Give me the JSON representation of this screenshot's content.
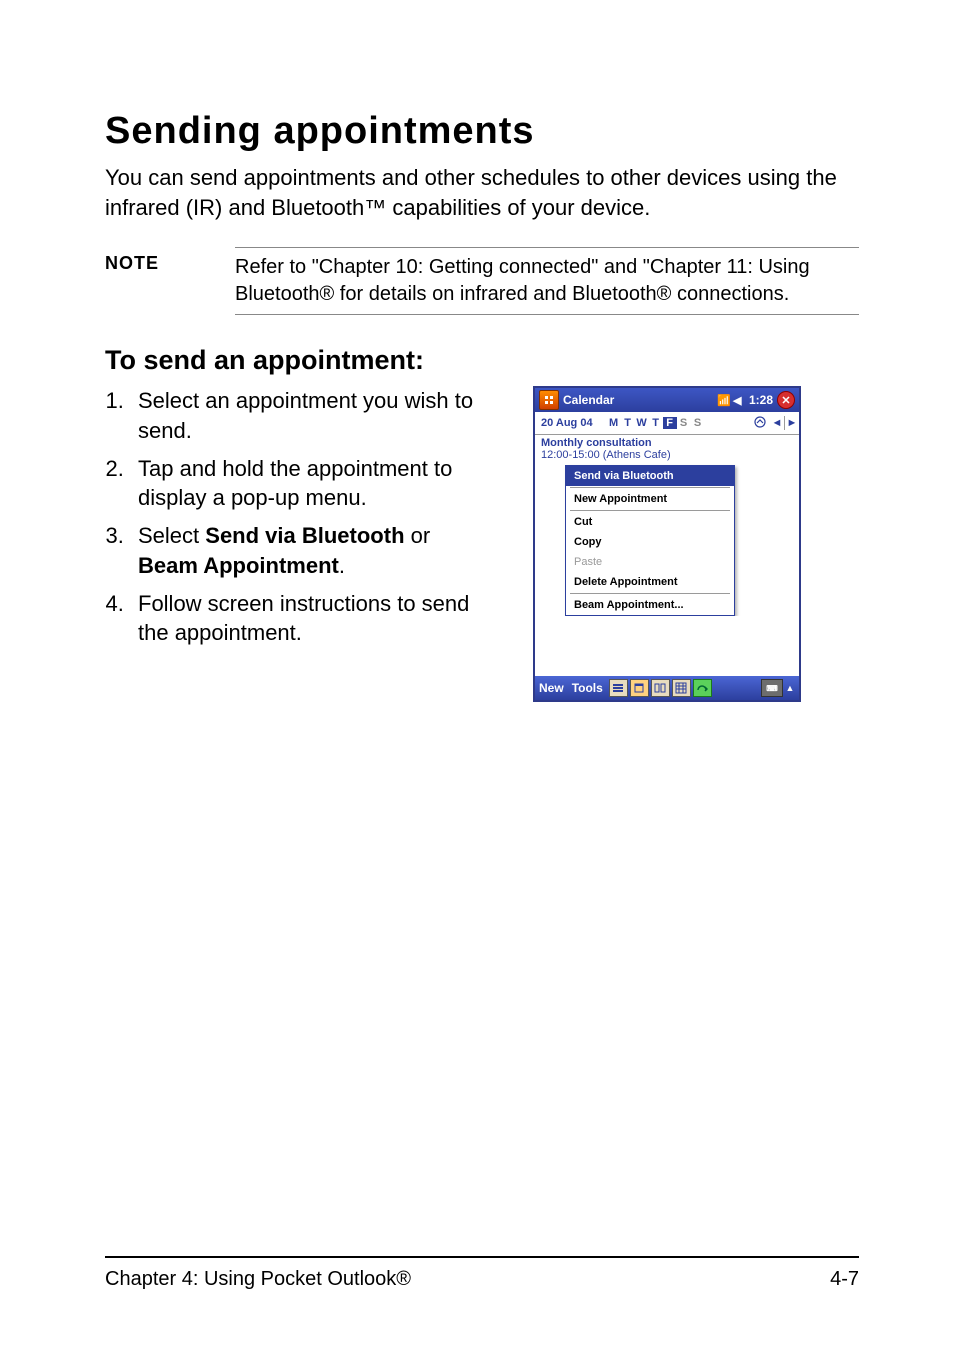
{
  "heading": "Sending appointments",
  "intro": "You can send appointments and other schedules to other devices using the infrared (IR) and Bluetooth™ capabilities of your device.",
  "note_label": "NOTE",
  "note_body": "Refer to \"Chapter 10: Getting connected\" and \"Chapter 11: Using Bluetooth® for details on infrared and Bluetooth® connections.",
  "subheading": "To send an appointment:",
  "steps": {
    "s1": "Select an appointment you wish to send.",
    "s2": "Tap and hold the appointment to display a pop-up menu.",
    "s3_pre": "Select ",
    "s3_b1": "Send via Bluetooth",
    "s3_mid": " or ",
    "s3_b2": "Beam Appointment",
    "s3_post": ".",
    "s4": "Follow screen instructions to send the appointment."
  },
  "shot": {
    "app_title": "Calendar",
    "time": "1:28",
    "date": "20 Aug 04",
    "weekdays": [
      "M",
      "T",
      "W",
      "T",
      "F",
      "S",
      "S"
    ],
    "event_title": "Monthly consultation",
    "event_sub": "12:00-15:00 (Athens Cafe)",
    "menu": {
      "send_bt": "Send via Bluetooth",
      "new_appt": "New Appointment",
      "cut": "Cut",
      "copy": "Copy",
      "paste": "Paste",
      "del": "Delete Appointment",
      "beam": "Beam Appointment..."
    },
    "bottom_new": "New",
    "bottom_tools": "Tools"
  },
  "footer": {
    "left": "Chapter 4: Using Pocket Outlook®",
    "right": "4-7"
  }
}
